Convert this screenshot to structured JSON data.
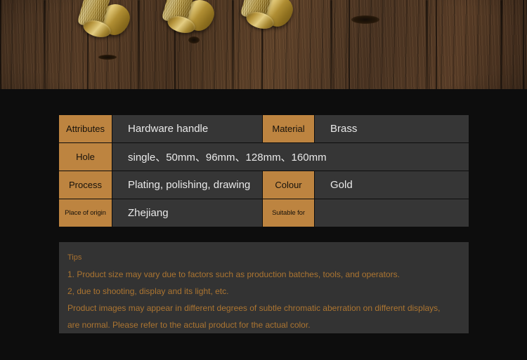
{
  "page": {
    "background_color": "#0d0d0d"
  },
  "hero": {
    "name": "brass-cabinet-handles-on-wood",
    "alt": "Three gold brass knurled cabinet handles lying on a dark brown wooden board",
    "colors": {
      "wood_dark": "#3e2a1b",
      "wood_mid": "#5a3e27",
      "wood_light": "#63452b",
      "brass_light": "#efdc96",
      "brass_mid": "#c3a244",
      "brass_dark": "#6a5113"
    },
    "handle_count": 3
  },
  "spec_table": {
    "label_color": "#bd8440",
    "value_color": "#363636",
    "rows": [
      {
        "label1": "Attributes",
        "value1": "Hardware handle",
        "label2": "Material",
        "value2": "Brass"
      },
      {
        "label1": "Hole",
        "value1": "single、50mm、96mm、128mm、160mm",
        "label2": "",
        "value2": ""
      },
      {
        "label1": "Process",
        "value1": "Plating, polishing, drawing",
        "label2": "Colour",
        "value2": "Gold"
      },
      {
        "label1": "Place of origin",
        "value1": "Zhejiang",
        "label2": "Suitable for",
        "value2": ""
      }
    ]
  },
  "tips": {
    "background_color": "#333333",
    "text_color": "#a8702f",
    "title": "Tips",
    "lines": [
      "1. Product size may vary due to factors such as production batches, tools, and operators.",
      "2, due to shooting, display and its light, etc.",
      "Product images may appear in different degrees of subtle chromatic aberration on different displays,",
      "are normal. Please refer to the actual product for the actual color."
    ]
  }
}
